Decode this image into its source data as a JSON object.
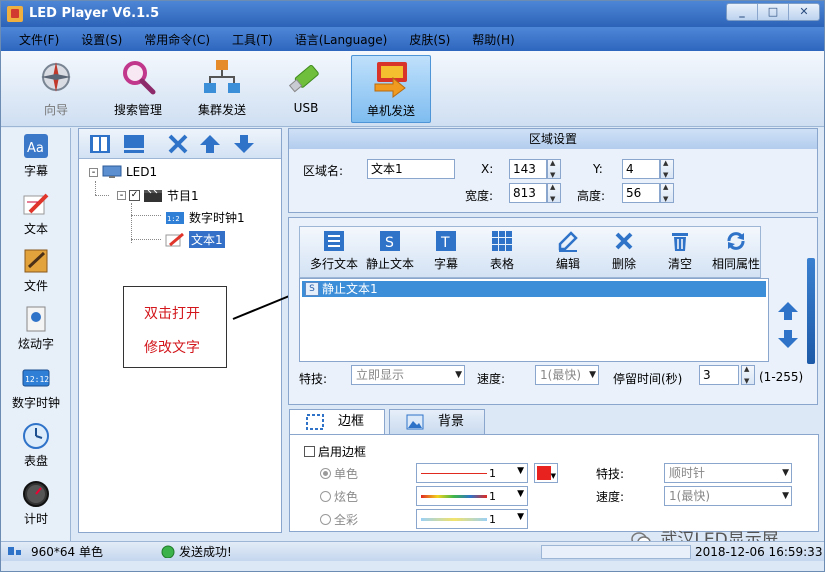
{
  "window": {
    "title": "LED Player V6.1.5"
  },
  "menu": [
    "文件(F)",
    "设置(S)",
    "常用命令(C)",
    "工具(T)",
    "语言(Language)",
    "皮肤(S)",
    "帮助(H)"
  ],
  "toolbar": [
    {
      "label": "向导",
      "icon": "compass-icon"
    },
    {
      "label": "搜索管理",
      "icon": "magnifier-icon"
    },
    {
      "label": "集群发送",
      "icon": "network-icon"
    },
    {
      "label": "USB",
      "icon": "usb-icon"
    },
    {
      "label": "单机发送",
      "icon": "send-icon",
      "active": true
    }
  ],
  "sidebar": [
    {
      "label": "字幕",
      "icon": "font-icon"
    },
    {
      "label": "文本",
      "icon": "text-pen-icon"
    },
    {
      "label": "文件",
      "icon": "file-icon"
    },
    {
      "label": "炫动字",
      "icon": "dynamic-text-icon"
    },
    {
      "label": "数字时钟",
      "icon": "digital-clock-icon"
    },
    {
      "label": "表盘",
      "icon": "dial-icon"
    },
    {
      "label": "计时",
      "icon": "timer-icon"
    }
  ],
  "tree": {
    "root": "LED1",
    "program": "节目1",
    "items": [
      "数字时钟1",
      "文本1"
    ],
    "selected": "文本1"
  },
  "annotation": {
    "line1": "双击打开",
    "line2": "修改文字"
  },
  "region": {
    "title": "区域设置",
    "name_label": "区域名:",
    "name_value": "文本1",
    "x_label": "X:",
    "x_value": "143",
    "y_label": "Y:",
    "y_value": "4",
    "width_label": "宽度:",
    "width_value": "813",
    "height_label": "高度:",
    "height_value": "56"
  },
  "content": {
    "tools": [
      "多行文本",
      "静止文本",
      "字幕",
      "表格",
      "编辑",
      "删除",
      "清空",
      "相同属性"
    ],
    "list": [
      "静止文本1"
    ],
    "effect_label": "特技:",
    "effect_value": "立即显示",
    "speed_label": "速度:",
    "speed_value": "1(最快)",
    "stay_label": "停留时间(秒)",
    "stay_value": "3",
    "stay_range": "(1-255)"
  },
  "border": {
    "tabs": [
      "边框",
      "背景"
    ],
    "enable_label": "启用边框",
    "radios": [
      "单色",
      "炫色",
      "全彩"
    ],
    "line_values": [
      "1",
      "1",
      "1"
    ],
    "effect_label": "特技:",
    "effect_value": "顺时针",
    "speed_label": "速度:",
    "speed_value": "1(最快)",
    "color": "#e8221e"
  },
  "status": {
    "resolution": "960*64 单色",
    "message": "发送成功!",
    "datetime": "2018-12-06 16:59:33"
  },
  "watermark": "武汉LED显示屏"
}
